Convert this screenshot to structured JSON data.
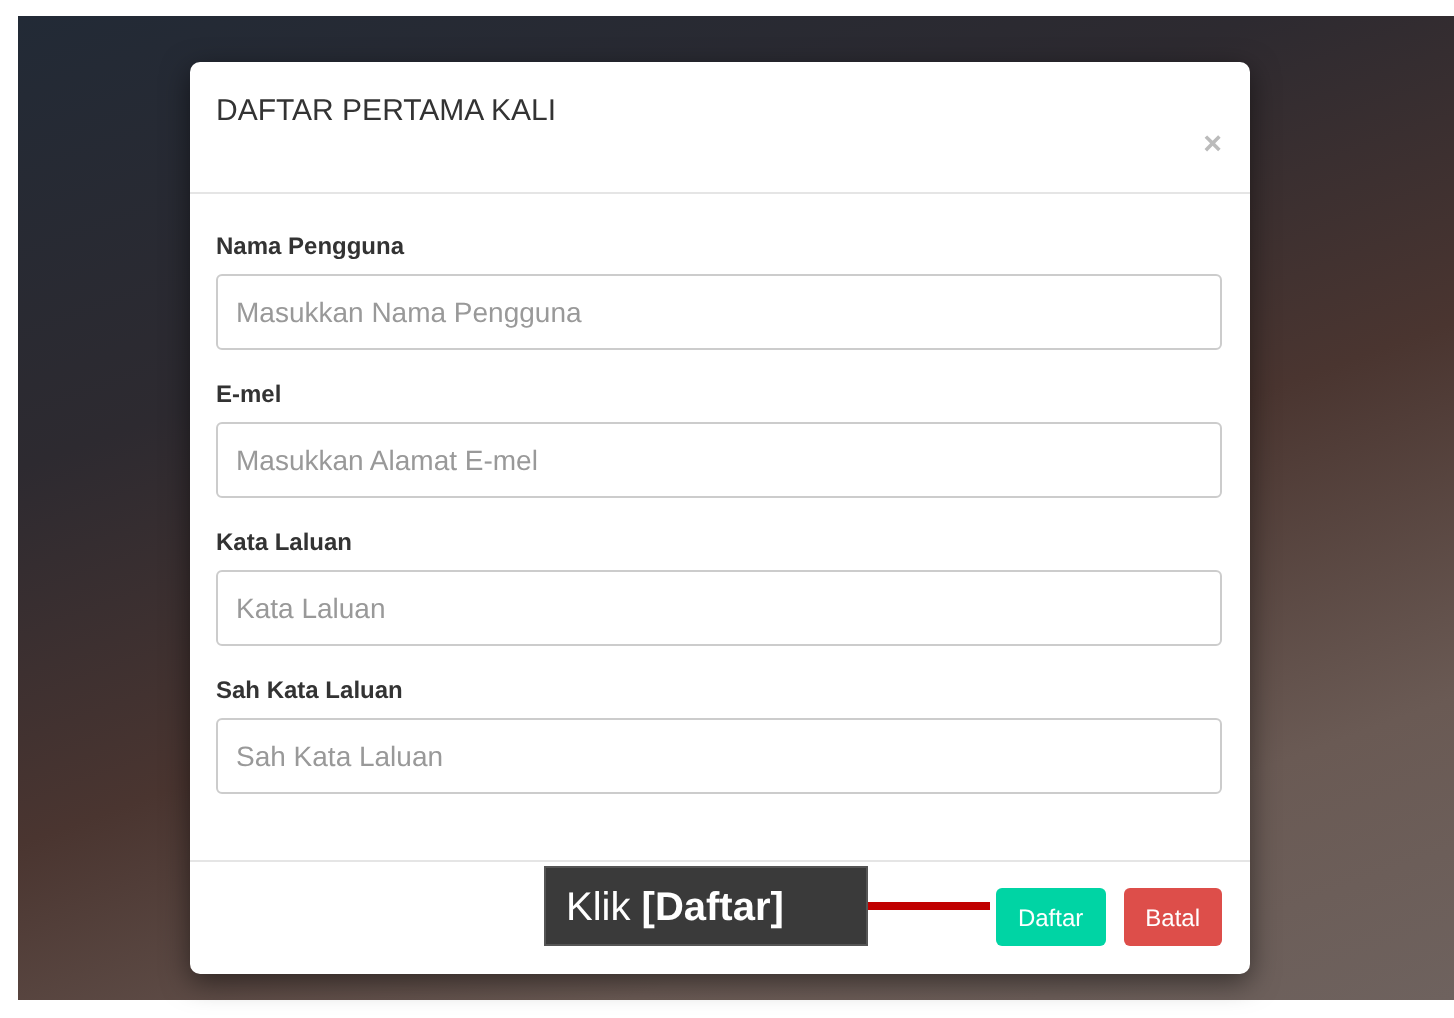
{
  "modal": {
    "title": "DAFTAR PERTAMA KALI",
    "close": "×"
  },
  "fields": [
    {
      "label": "Nama Pengguna",
      "placeholder": "Masukkan Nama Pengguna"
    },
    {
      "label": "E-mel",
      "placeholder": "Masukkan Alamat E-mel"
    },
    {
      "label": "Kata Laluan",
      "placeholder": "Kata Laluan"
    },
    {
      "label": "Sah Kata Laluan",
      "placeholder": "Sah Kata Laluan"
    }
  ],
  "buttons": [
    {
      "label": "Daftar",
      "kind": "primary"
    },
    {
      "label": "Batal",
      "kind": "danger"
    }
  ],
  "callout": {
    "text": "Klik **[Daftar]**"
  }
}
